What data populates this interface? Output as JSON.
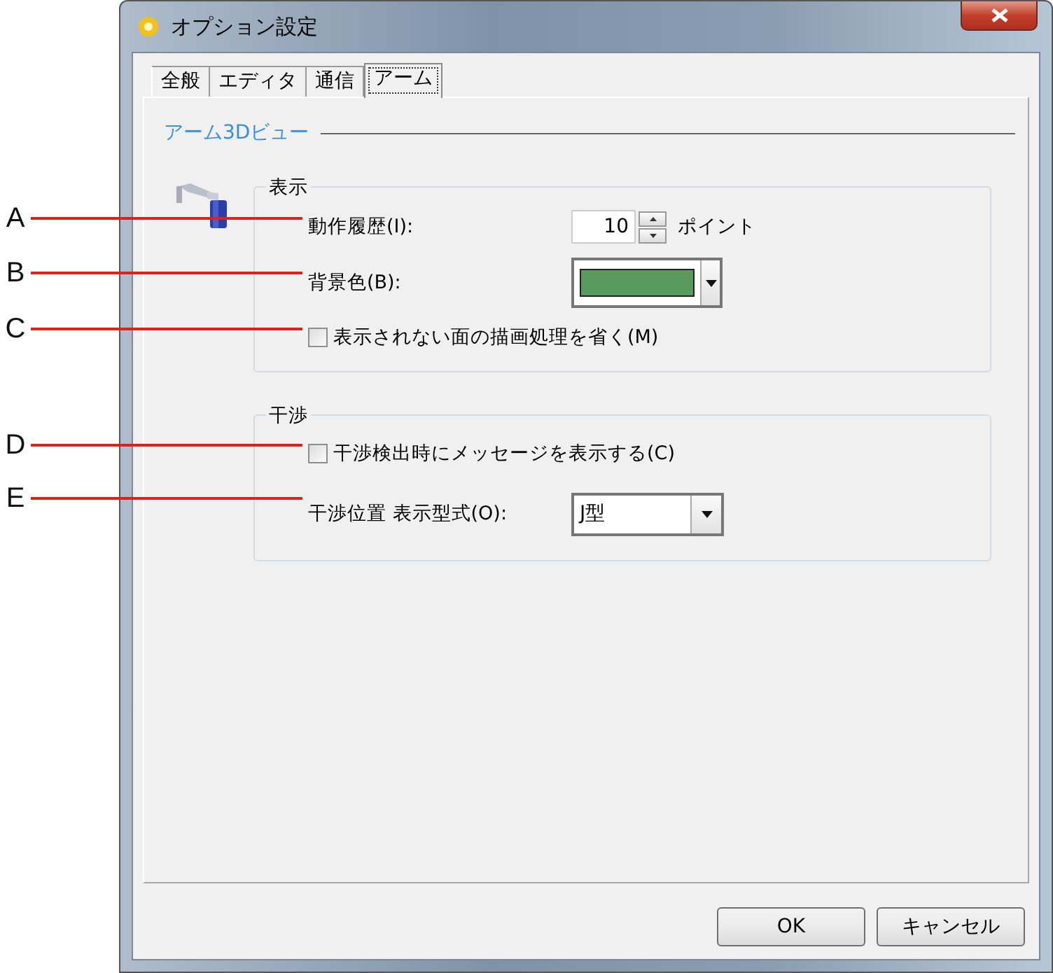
{
  "window": {
    "title": "オプション設定"
  },
  "tabs": [
    {
      "label": "全般",
      "selected": false
    },
    {
      "label": "エディタ",
      "selected": false
    },
    {
      "label": "通信",
      "selected": false
    },
    {
      "label": "アーム",
      "selected": true
    }
  ],
  "section": {
    "title": "アーム3Dビュー"
  },
  "display_group": {
    "title": "表示",
    "history": {
      "label": "動作履歴(I):",
      "value": "10",
      "unit": "ポイント"
    },
    "background": {
      "label": "背景色(B):",
      "color": "#5a9a5c"
    },
    "cull": {
      "label": "表示されない面の描画処理を省く(M)",
      "checked": false
    }
  },
  "interference_group": {
    "title": "干渉",
    "message": {
      "label": "干渉検出時にメッセージを表示する(C)",
      "checked": false
    },
    "position_format": {
      "label": "干渉位置 表示型式(O):",
      "value": "J型"
    }
  },
  "buttons": [
    "OK",
    "キャンセル"
  ],
  "callouts": [
    {
      "letter": "A"
    },
    {
      "letter": "B"
    },
    {
      "letter": "C"
    },
    {
      "letter": "D"
    },
    {
      "letter": "E"
    }
  ]
}
